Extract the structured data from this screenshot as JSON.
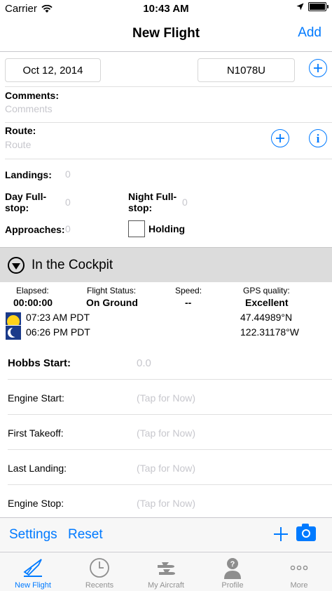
{
  "status_bar": {
    "carrier": "Carrier",
    "time": "10:43 AM"
  },
  "nav": {
    "title": "New Flight",
    "add_label": "Add"
  },
  "flight": {
    "date": "Oct 12, 2014",
    "tail": "N1078U"
  },
  "comments": {
    "label": "Comments:",
    "placeholder": "Comments"
  },
  "route": {
    "label": "Route:",
    "placeholder": "Route"
  },
  "landings": {
    "label": "Landings:",
    "value": "0"
  },
  "day_fullstop": {
    "label_line1": "Day Full-",
    "label_line2": "stop:",
    "value": "0"
  },
  "night_fullstop": {
    "label_line1": "Night Full-",
    "label_line2": "stop:",
    "value": "0"
  },
  "approaches": {
    "label": "Approaches:",
    "value": "0"
  },
  "holding": {
    "label": "Holding"
  },
  "cockpit": {
    "title": "In the Cockpit",
    "elapsed_label": "Elapsed:",
    "elapsed_value": "00:00:00",
    "status_label": "Flight Status:",
    "status_value": "On Ground",
    "speed_label": "Speed:",
    "speed_value": "--",
    "gps_label": "GPS quality:",
    "gps_value": "Excellent",
    "sunrise": "07:23 AM PDT",
    "sunset": "06:26 PM PDT",
    "latitude": "47.44989°N",
    "longitude": "122.31178°W"
  },
  "times": {
    "hobbs_label": "Hobbs Start:",
    "hobbs_value": "0.0",
    "engine_start_label": "Engine Start:",
    "engine_start_value": "(Tap for Now)",
    "first_takeoff_label": "First Takeoff:",
    "first_takeoff_value": "(Tap for Now)",
    "last_landing_label": "Last Landing:",
    "last_landing_value": "(Tap for Now)",
    "engine_stop_label": "Engine Stop:",
    "engine_stop_value": "(Tap for Now)"
  },
  "toolbar": {
    "settings_label": "Settings",
    "reset_label": "Reset"
  },
  "tabs": [
    {
      "label": "New Flight",
      "icon": "new-flight-icon",
      "active": true
    },
    {
      "label": "Recents",
      "icon": "clock-icon",
      "active": false
    },
    {
      "label": "My Aircraft",
      "icon": "aircraft-icon",
      "active": false
    },
    {
      "label": "Profile",
      "icon": "profile-icon",
      "active": false
    },
    {
      "label": "More",
      "icon": "more-icon",
      "active": false
    }
  ],
  "colors": {
    "accent": "#007aff",
    "placeholder": "#c7c7cd",
    "section_bg": "#dcdcdc"
  }
}
